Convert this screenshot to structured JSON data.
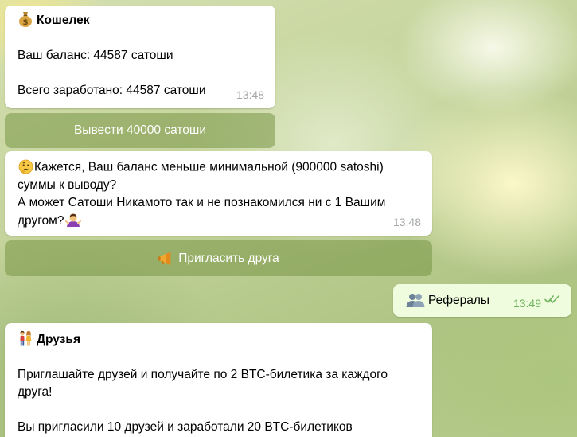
{
  "messages": {
    "wallet": {
      "title": "Кошелек",
      "title_icon": "money-bag-icon",
      "line_balance": "Ваш баланс: 44587 сатоши",
      "line_earned": "Всего заработано: 44587 сатоши",
      "time": "13:48"
    },
    "withdraw_button": {
      "label": "Вывести 40000 сатоши"
    },
    "low_balance": {
      "icon": "thinking-face-icon",
      "line1": "Кажется, Ваш баланс меньше минимальной (900000 satoshi)",
      "line2": "суммы к выводу?",
      "line3": "А может Сатоши Никамото так и не познакомился ни с 1 Вашим",
      "line4": "другом?",
      "end_icon": "shrug-icon",
      "time": "13:48"
    },
    "invite_button": {
      "label": "Пригласить друга",
      "icon": "megaphone-icon"
    },
    "referrals_outgoing": {
      "icon": "people-icon",
      "text": "Рефералы",
      "time": "13:49",
      "status": "read"
    },
    "friends": {
      "title": "Друзья",
      "title_icon": "couple-icon",
      "line1": "Приглашайте друзей и получайте по 2 BTC-билетика за каждого",
      "line2": "друга!",
      "line3": "Вы пригласили 10 друзей и заработали 20 BTC-билетиков"
    }
  },
  "colors": {
    "incoming_bubble": "#ffffff",
    "outgoing_bubble": "#effdde",
    "inline_button": "#8fa85f",
    "read_ticks": "#6fb35f"
  }
}
